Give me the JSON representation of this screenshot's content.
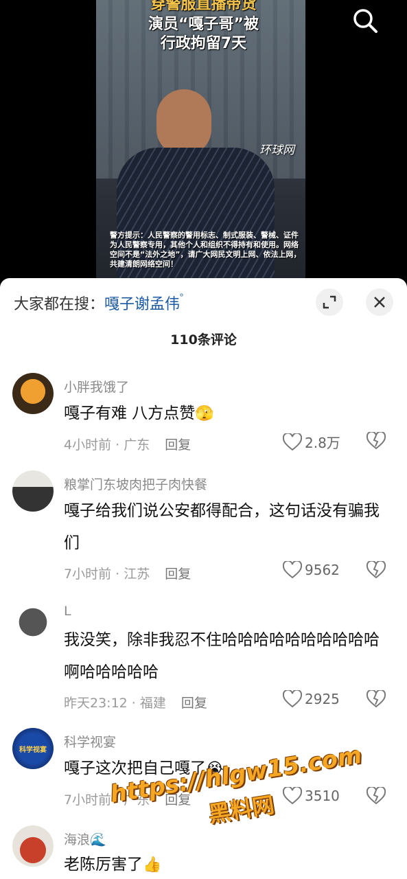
{
  "video": {
    "title_lines": [
      "穿警服直播带货",
      "演员“嘎子哥”被",
      "行政拘留7天"
    ],
    "source_watermark": "环球网",
    "notice": "警方提示：人民警察的警用标志、制式服装、警械、证件为人民警察专用，其他个人和组织不得持有和使用。网络空间不是“法外之地”，请广大网民文明上网、依法上网，共建清朗网络空间！",
    "search_icon": "search-icon"
  },
  "panel": {
    "hot_search_label": "大家都在搜：",
    "hot_search_term": "嘎子谢孟伟",
    "comment_count": "110条评论"
  },
  "comments": [
    {
      "user": "小胖我饿了",
      "text": "嘎子有难 八方点赞",
      "emoji": "🫣",
      "time": "4小时前 · 广东",
      "reply": "回复",
      "likes": "2.8万"
    },
    {
      "user": "粮掌门东坡肉把子肉快餐",
      "text": "嘎子给我们说公安都得配合，这句话没有骗我们",
      "emoji": "",
      "time": "7小时前 · 江苏",
      "reply": "回复",
      "likes": "9562"
    },
    {
      "user": "L",
      "text": "我没笑，除非我忍不住哈哈哈哈哈哈哈哈哈哈啊哈哈哈哈哈",
      "emoji": "",
      "time": "昨天23:12 · 福建",
      "reply": "回复",
      "likes": "2925"
    },
    {
      "user": "科学视宴",
      "text": "嘎子这次把自己嘎了",
      "emoji": "😭",
      "time": "7小时前 · 广东",
      "reply": "回复",
      "likes": "3510",
      "avatar_text": "科学视宴"
    },
    {
      "user": "海浪🌊",
      "text": "老陈厉害了",
      "emoji": "👍",
      "time": "",
      "reply": "",
      "likes": ""
    }
  ],
  "promo": {
    "url": "https://hlgw15.com",
    "name": "黑料网"
  },
  "colors": {
    "accent": "#1c5aa3",
    "promo": "#f5a623"
  }
}
